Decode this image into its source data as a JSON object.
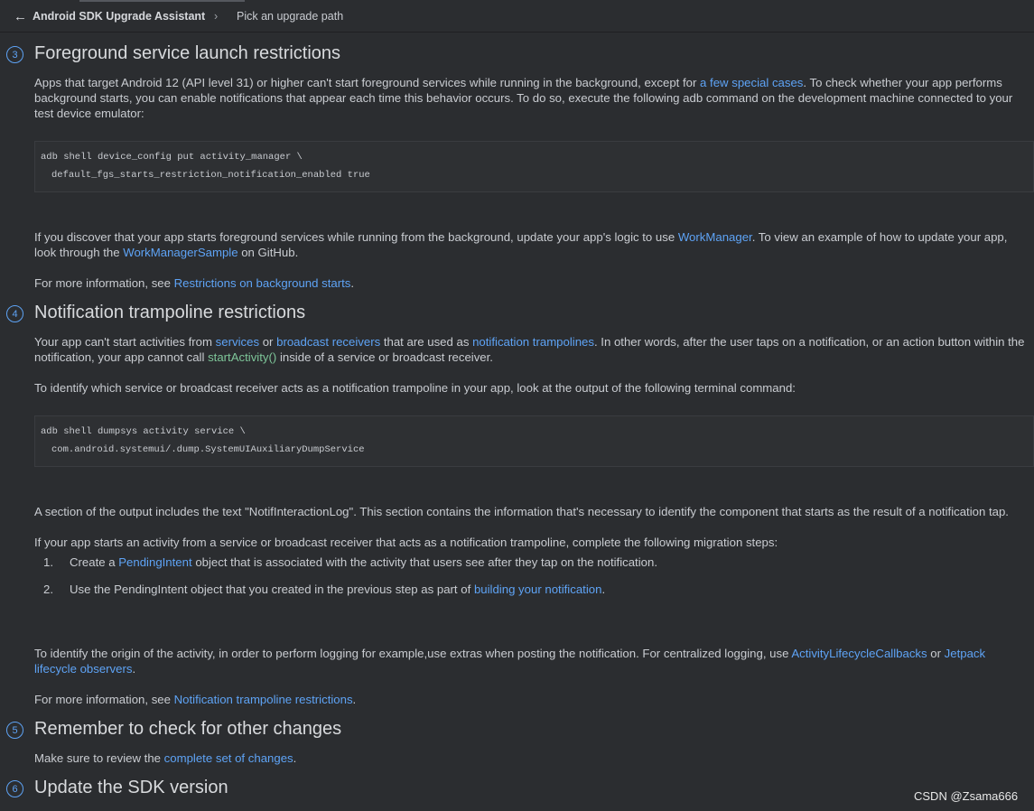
{
  "header": {
    "back_icon": "←",
    "title": "Android SDK Upgrade Assistant",
    "separator": "›",
    "current": "Pick an upgrade path"
  },
  "section3": {
    "number": "3",
    "title": "Foreground service launch restrictions",
    "p1": {
      "t1": "Apps that target Android 12 (API level 31) or higher can't start foreground services while running in the background, except for ",
      "link1": "a few special cases",
      "t2": ". To check whether your app performs background starts, you can enable notifications that appear each time this behavior occurs. To do so, execute the following adb command on the development machine connected to your test device emulator:"
    },
    "code_line1": "adb shell device_config put activity_manager \\",
    "code_line2": "default_fgs_starts_restriction_notification_enabled true",
    "p2": {
      "t1": "If you discover that your app starts foreground services while running from the background, update your app's logic to use ",
      "link1": "WorkManager",
      "t2": ". To view an example of how to update your app, look through the ",
      "link2": "WorkManagerSample",
      "t3": " on GitHub."
    },
    "p3": {
      "t1": "For more information, see ",
      "link1": "Restrictions on background starts",
      "t2": "."
    }
  },
  "section4": {
    "number": "4",
    "title": "Notification trampoline restrictions",
    "p1": {
      "t1": "Your app can't start activities from ",
      "link1": "services",
      "t2": " or ",
      "link2": "broadcast receivers",
      "t3": " that are used as ",
      "link3": "notification trampolines",
      "t4": ". In other words, after the user taps on a notification, or an action button within the notification, your app cannot call ",
      "code1": "startActivity()",
      "t5": " inside of a service or broadcast receiver."
    },
    "p2": "To identify which service or broadcast receiver acts as a notification trampoline in your app, look at the output of the following terminal command:",
    "code_line1": "adb shell dumpsys activity service \\",
    "code_line2": "com.android.systemui/.dump.SystemUIAuxiliaryDumpService",
    "p3": "A section of the output includes the text \"NotifInteractionLog\". This section contains the information that's necessary to identify the component that starts as the result of a notification tap.",
    "p4": "If your app starts an activity from a service or broadcast receiver that acts as a notification trampoline, complete the following migration steps:",
    "steps": [
      {
        "num": "1.",
        "t1": "Create a ",
        "link1": "PendingIntent",
        "t2": " object that is associated with the activity that users see after they tap on the notification."
      },
      {
        "num": "2.",
        "t1": "Use the PendingIntent object that you created in the previous step as part of ",
        "link1": "building your notification",
        "t2": "."
      }
    ],
    "p5": {
      "t1": "To identify the origin of the activity, in order to perform logging for example,use extras when posting the notification. For centralized logging, use ",
      "link1": "ActivityLifecycleCallbacks",
      "t2": " or ",
      "link2": "Jetpack lifecycle observers",
      "t3": "."
    },
    "p6": {
      "t1": "For more information, see ",
      "link1": "Notification trampoline restrictions",
      "t2": "."
    }
  },
  "section5": {
    "number": "5",
    "title": "Remember to check for other changes",
    "p1": {
      "t1": "Make sure to review the ",
      "link1": "complete set of changes",
      "t2": "."
    }
  },
  "section6": {
    "number": "6",
    "title": "Update the SDK version"
  },
  "watermark": "CSDN @Zsama666",
  "colors": {
    "background": "#2b2d30",
    "link": "#5ea3f5",
    "text": "#c9ccd1"
  }
}
